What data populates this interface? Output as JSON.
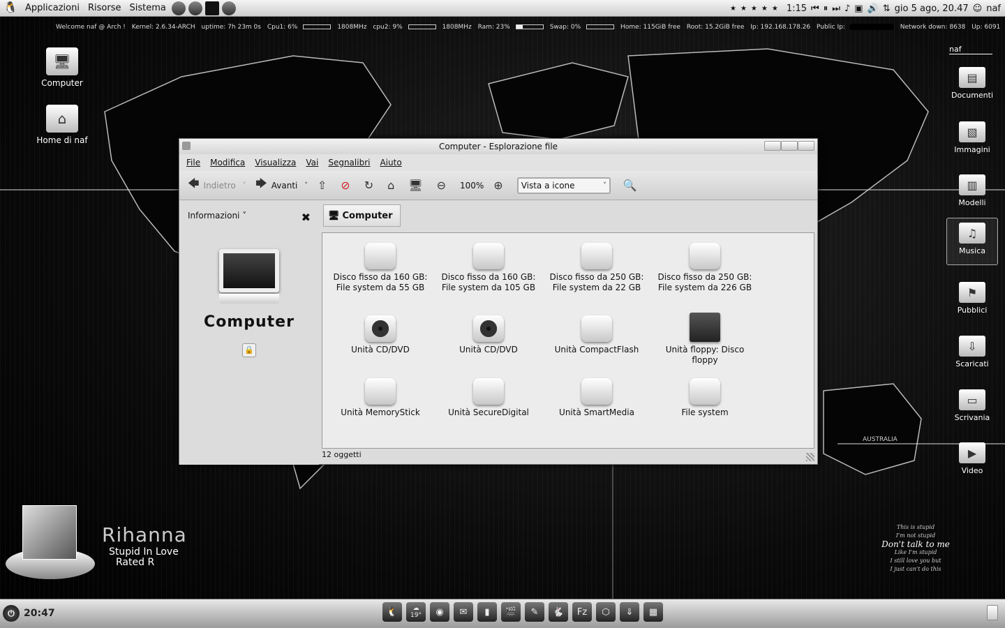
{
  "top_panel": {
    "menus": [
      "Applicazioni",
      "Risorse",
      "Sistema"
    ],
    "track_time": "1:15",
    "datetime": "gio 5 ago, 20.47",
    "user": "naf"
  },
  "conky": {
    "welcome": "Welcome naf @ Arch !",
    "kernel": "Kernel: 2.6.34-ARCH",
    "uptime": "uptime: 7h 23m 0s",
    "cpu1": "Cpu1: 6%",
    "cpu1_freq": "1808MHz",
    "cpu2": "cpu2: 9%",
    "cpu2_freq": "1808MHz",
    "ram": "Ram: 23%",
    "ram_level": 0.23,
    "swap": "Swap: 0%",
    "home": "Home: 115GiB free",
    "root": "Root: 15.2GiB free",
    "ip": "Ip: 192.168.178.26",
    "public_ip": "Public Ip:",
    "net_down": "Network down: 8638",
    "net_up": "Up: 6091"
  },
  "desktop_left": [
    "Computer",
    "Home di naf"
  ],
  "desktop_right": {
    "user_label": "naf",
    "items": [
      "Documenti",
      "Immagini",
      "Modelli",
      "Musica",
      "Pubblici",
      "Scaricati",
      "Scrivania",
      "Video"
    ]
  },
  "window": {
    "title": "Computer - Esplorazione file",
    "menus": [
      "File",
      "Modifica",
      "Visualizza",
      "Vai",
      "Segnalibri",
      "Aiuto"
    ],
    "toolbar": {
      "back": "Indietro",
      "forward": "Avanti",
      "zoom": "100%",
      "view": "Vista a icone"
    },
    "sidebar": {
      "header": "Informazioni",
      "title": "Computer"
    },
    "path": "Computer",
    "items": [
      "Disco fisso da 160 GB: File system da 55 GB",
      "Disco fisso da 160 GB: File system da 105 GB",
      "Disco fisso da 250 GB: File system da 22 GB",
      "Disco fisso da 250 GB: File system da 226 GB",
      "Unità CD/DVD",
      "Unità CD/DVD",
      "Unità CompactFlash",
      "Unità floppy: Disco floppy",
      "Unità MemoryStick",
      "Unità SecureDigital",
      "Unità SmartMedia",
      "File system"
    ],
    "status": "12 oggetti"
  },
  "music": {
    "artist": "Rihanna",
    "song": "Stupid In Love",
    "album": "Rated R"
  },
  "lyrics": [
    "This is stupid",
    "I'm not stupid",
    "Don't talk to me",
    "Like I'm stupid",
    "I still love you but",
    "I just can't do this"
  ],
  "map_label": "AUSTRALIA",
  "bottom_panel": {
    "clock": "20:47",
    "weather_temp": "19°"
  }
}
